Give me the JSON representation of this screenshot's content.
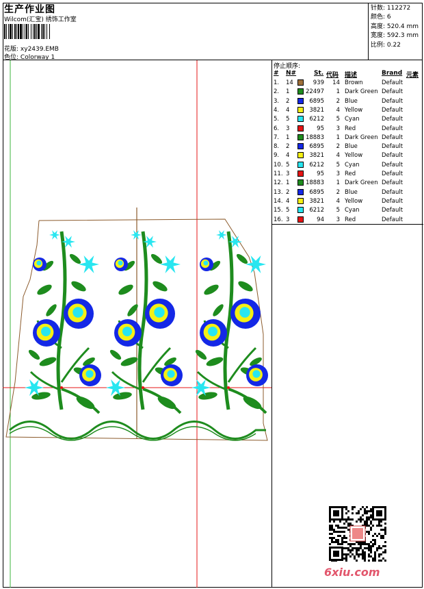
{
  "header": {
    "title": "生产作业图",
    "subtitle": "Wilcom(汇宝) 绣饰工作室",
    "pattern_label": "花版:",
    "pattern_value": "xy2439.EMB",
    "colorway_label": "色位:",
    "colorway_value": "Colorway 1"
  },
  "stats": {
    "stitches": "针数: 112272",
    "colors": "颜色: 6",
    "height": "高度: 520.4 mm",
    "width": "宽度: 592.3 mm",
    "scale": "比例: 0.22"
  },
  "sequence": {
    "title": "停止顺序:",
    "headers": {
      "num": "#",
      "n": "N#",
      "st": "St.",
      "code": "代码",
      "desc": "描述",
      "brand": "Brand",
      "element": "元素"
    },
    "rows": [
      {
        "num": "1.",
        "n": "14",
        "color": "#A0703A",
        "st": "939",
        "code": "14",
        "desc": "Brown",
        "brand": "Default"
      },
      {
        "num": "2.",
        "n": "1",
        "color": "#1E8C1E",
        "st": "22497",
        "code": "1",
        "desc": "Dark Green",
        "brand": "Default"
      },
      {
        "num": "3.",
        "n": "2",
        "color": "#1428E6",
        "st": "6895",
        "code": "2",
        "desc": "Blue",
        "brand": "Default"
      },
      {
        "num": "4.",
        "n": "4",
        "color": "#F5F014",
        "st": "3821",
        "code": "4",
        "desc": "Yellow",
        "brand": "Default"
      },
      {
        "num": "5.",
        "n": "5",
        "color": "#28E6F0",
        "st": "6212",
        "code": "5",
        "desc": "Cyan",
        "brand": "Default"
      },
      {
        "num": "6.",
        "n": "3",
        "color": "#E61414",
        "st": "95",
        "code": "3",
        "desc": "Red",
        "brand": "Default"
      },
      {
        "num": "7.",
        "n": "1",
        "color": "#1E8C1E",
        "st": "18883",
        "code": "1",
        "desc": "Dark Green",
        "brand": "Default"
      },
      {
        "num": "8.",
        "n": "2",
        "color": "#1428E6",
        "st": "6895",
        "code": "2",
        "desc": "Blue",
        "brand": "Default"
      },
      {
        "num": "9.",
        "n": "4",
        "color": "#F5F014",
        "st": "3821",
        "code": "4",
        "desc": "Yellow",
        "brand": "Default"
      },
      {
        "num": "10.",
        "n": "5",
        "color": "#28E6F0",
        "st": "6212",
        "code": "5",
        "desc": "Cyan",
        "brand": "Default"
      },
      {
        "num": "11.",
        "n": "3",
        "color": "#E61414",
        "st": "95",
        "code": "3",
        "desc": "Red",
        "brand": "Default"
      },
      {
        "num": "12.",
        "n": "1",
        "color": "#1E8C1E",
        "st": "18883",
        "code": "1",
        "desc": "Dark Green",
        "brand": "Default"
      },
      {
        "num": "13.",
        "n": "2",
        "color": "#1428E6",
        "st": "6895",
        "code": "2",
        "desc": "Blue",
        "brand": "Default"
      },
      {
        "num": "14.",
        "n": "4",
        "color": "#F5F014",
        "st": "3821",
        "code": "4",
        "desc": "Yellow",
        "brand": "Default"
      },
      {
        "num": "15.",
        "n": "5",
        "color": "#28E6F0",
        "st": "6212",
        "code": "5",
        "desc": "Cyan",
        "brand": "Default"
      },
      {
        "num": "16.",
        "n": "3",
        "color": "#E61414",
        "st": "94",
        "code": "3",
        "desc": "Red",
        "brand": "Default"
      }
    ]
  },
  "watermark": "6xiu.com",
  "palette": {
    "green": "#1E8C1E",
    "blue": "#1428E6",
    "yellow": "#F5F014",
    "cyan": "#28E6F0",
    "red": "#E61414",
    "brown": "#8B5A2B"
  }
}
